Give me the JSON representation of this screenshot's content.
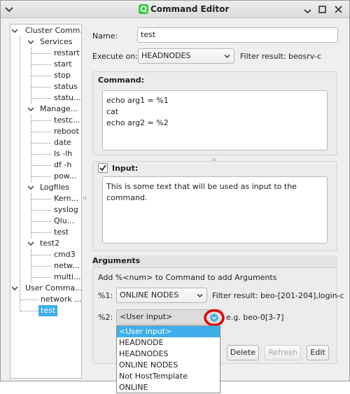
{
  "window": {
    "title": "Command Editor"
  },
  "tree": {
    "root": "Cluster Comm...",
    "groups": [
      {
        "label": "Services",
        "children": [
          "restart",
          "start",
          "stop",
          "status",
          "statu..."
        ]
      },
      {
        "label": "Manage...",
        "children": [
          "testc...",
          "reboot",
          "date",
          "ls -lh",
          "df -h",
          "pow..."
        ]
      },
      {
        "label": "Logfiles",
        "children": [
          "Kern...",
          "syslog",
          "Qlu...",
          "test"
        ]
      },
      {
        "label": "test2",
        "children": [
          "cmd3",
          "netw...",
          "multi..."
        ]
      }
    ],
    "user_root": "User Comma...",
    "user_children": [
      "network ...",
      "test"
    ]
  },
  "form": {
    "name_label": "Name:",
    "name_value": "test",
    "execute_label": "Execute on:",
    "execute_value": "HEADNODES",
    "execute_filter": "Filter result: beosrv-c",
    "command_label": "Command:",
    "command_text": "echo arg1 = %1\ncat\necho arg2 = %2",
    "input_label": "Input:",
    "input_checked": true,
    "input_text": "This is some text that will be used as input to the command.",
    "arguments_label": "Arguments",
    "arguments_hint": "Add %<num> to Command to add Arguments",
    "arg1_label": "%1:",
    "arg1_value": "ONLINE NODES",
    "arg1_filter": "Filter result: beo-[201-204],login-c",
    "arg2_label": "%2:",
    "arg2_value": "<User input>",
    "arg2_hint": "e.g. beo-0[3-7]"
  },
  "buttons": {
    "delete": "Delete",
    "refresh": "Refresh",
    "edit": "Edit"
  },
  "dropdown": {
    "options": [
      "<User input>",
      "HEADNODE",
      "HEADNODES",
      "ONLINE NODES",
      "Not HostTemplate",
      "ONLINE"
    ],
    "selected_index": 0
  },
  "colors": {
    "accent": "#3daee9",
    "highlight_ring": "#e00000",
    "app_icon": "#2ecc40"
  }
}
